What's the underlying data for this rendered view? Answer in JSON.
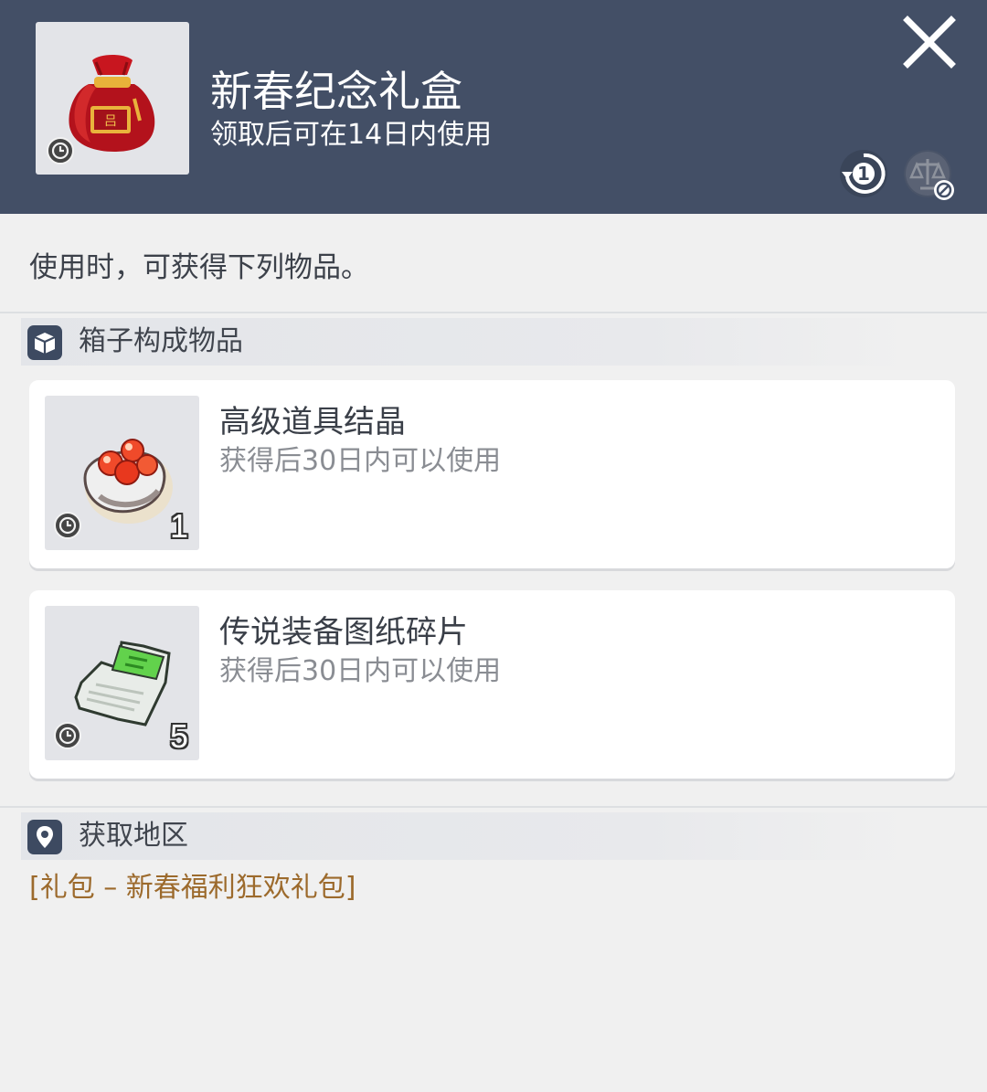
{
  "header": {
    "title": "新春纪念礼盒",
    "subtitle": "领取后可在14日内使用",
    "item_icon": "red-lucky-bag-icon",
    "close_icon": "close-icon",
    "badges": [
      "trade-limit-1-icon",
      "no-trade-scale-icon"
    ]
  },
  "description": "使用时，可获得下列物品。",
  "contents_section": {
    "title": "箱子构成物品",
    "icon": "box-icon",
    "items": [
      {
        "name": "高级道具结晶",
        "sub": "获得后30日内可以使用",
        "quantity": "1",
        "icon": "crystal-icon"
      },
      {
        "name": "传说装备图纸碎片",
        "sub": "获得后30日内可以使用",
        "quantity": "5",
        "icon": "blueprint-scroll-icon"
      }
    ]
  },
  "region_section": {
    "title": "获取地区",
    "icon": "location-pin-icon",
    "link_text": "[礼包 – 新春福利狂欢礼包]"
  },
  "colors": {
    "header_bg": "#434f66",
    "page_bg": "#f0f0f0",
    "link": "#9c6a2c"
  }
}
